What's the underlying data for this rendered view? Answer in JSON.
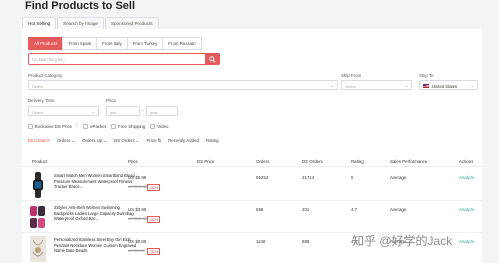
{
  "title": "Find Products to Sell",
  "tabs": [
    "Hot Selling",
    "Search by Image",
    "Sponsored Products"
  ],
  "categories": [
    "All Products",
    "From Spain",
    "From Italy",
    "From Turkey",
    "From Russian"
  ],
  "search": {
    "placeholder": "I'm searching for..."
  },
  "filters": {
    "product_category": {
      "label": "Product Category",
      "placeholder": "Select"
    },
    "ship_from": {
      "label": "Ship From",
      "placeholder": "Select"
    },
    "ship_to": {
      "label": "Ship To",
      "value": "United States"
    },
    "delivery_time": {
      "label": "Delivery Time",
      "placeholder": "Select"
    },
    "price": {
      "label": "Price",
      "min": "min",
      "max": "max"
    }
  },
  "options": [
    "Exclusive DS Price",
    "ePacket",
    "Free Shipping",
    "Video"
  ],
  "sort": [
    "Best Match",
    "Orders",
    "Orders Up",
    "DS Orders",
    "Price",
    "Recently Added",
    "Rating"
  ],
  "columns": [
    "Product",
    "Price",
    "DS Price",
    "Orders",
    "DS Orders",
    "Rating",
    "Sales Performance",
    "Actions"
  ],
  "rows": [
    {
      "name": "Smart Watch Men Women Smartband Blood Pressure Measurement Waterproof Fitness Tracker Brace...",
      "price": "US $5.99",
      "orig": "US $15.88",
      "disc": "-60%",
      "orders": "55254",
      "ds_orders": "21714",
      "rating": "5",
      "perf": "Average",
      "action": "Analyze"
    },
    {
      "name": "4Styles Anti-theft Women Swimming Backpacks Ladies Large Capacity Swimbag Waterproof Oxford Bac...",
      "price": "US $3.98",
      "orig": "US $12.68",
      "disc": "-60%",
      "orders": "596",
      "ds_orders": "201",
      "rating": "4.7",
      "perf": "Average",
      "action": "Analyze"
    },
    {
      "name": "Personalized Stainless Steel Boy Girl Kids Pendant Necklace Women Custom Engraved Name Date Beads",
      "price": "US $0.88",
      "orig": "US $1.25",
      "disc": "-30%",
      "orders": "1138",
      "ds_orders": "886",
      "rating": "4.8",
      "perf": "Average",
      "action": "Analyze"
    }
  ],
  "watermark": "知乎 @好学的Jack"
}
